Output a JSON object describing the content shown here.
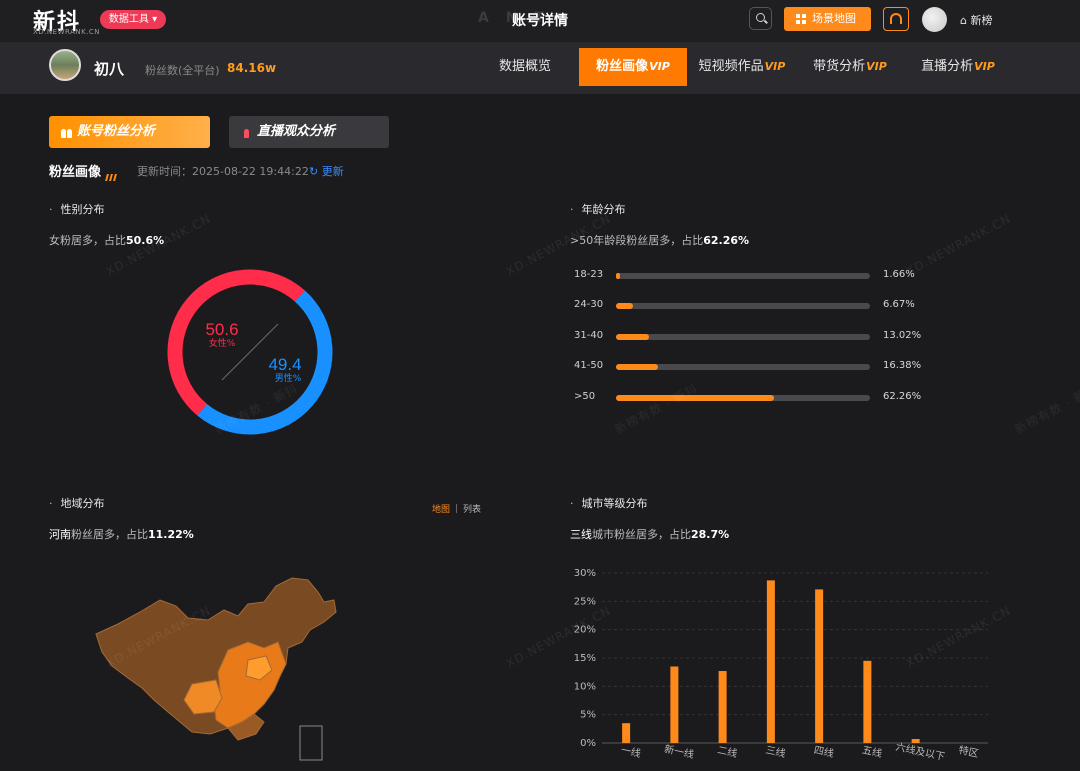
{
  "app": {
    "logo": "新抖",
    "logo_sub": "XD.NEWRANK.CN",
    "tools_badge": "数据工具 ▾",
    "page_title": "账号详情",
    "page_title_ghost": "A      N T",
    "scene_button": "场景地图",
    "home_link": "⌂ 新榜"
  },
  "account": {
    "name": "初八",
    "fans_label": "粉丝数(全平台)",
    "fans_value": "84.16w"
  },
  "nav": {
    "tabs": [
      {
        "label": "数据概览",
        "vip": ""
      },
      {
        "label": "粉丝画像",
        "vip": "VIP"
      },
      {
        "label": "短视频作品",
        "vip": "VIP"
      },
      {
        "label": "带货分析",
        "vip": "VIP"
      },
      {
        "label": "直播分析",
        "vip": "VIP"
      }
    ],
    "active": "粉丝画像"
  },
  "subtabs": {
    "account_fans": "账号粉丝分析",
    "live_audience": "直播观众分析"
  },
  "section": {
    "title": "粉丝画像",
    "update_time": "更新时间：2025-08-22 19:44:22",
    "refresh": "更新"
  },
  "gender": {
    "title": "性别分布",
    "summary_prefix": "女粉",
    "summary_mid": "居多，占比",
    "summary_value": "50.6%",
    "female_value": "50.6",
    "female_label": "女性%",
    "male_value": "49.4",
    "male_label": "男性%",
    "colors": {
      "female": "#ff2d4a",
      "male": "#1890ff"
    }
  },
  "age": {
    "title": "年龄分布",
    "summary_prefix": ">50年龄段粉丝",
    "summary_mid": "居多，占比",
    "summary_value": "62.26%",
    "rows": [
      {
        "label": "18-23",
        "pct": "1.66%",
        "value": 1.66
      },
      {
        "label": "24-30",
        "pct": "6.67%",
        "value": 6.67
      },
      {
        "label": "31-40",
        "pct": "13.02%",
        "value": 13.02
      },
      {
        "label": "41-50",
        "pct": "16.38%",
        "value": 16.38
      },
      {
        "label": ">50",
        "pct": "62.26%",
        "value": 62.26
      }
    ]
  },
  "region": {
    "title": "地域分布",
    "toggle_map": "地图",
    "toggle_list": "列表",
    "summary_prefix": "河南",
    "summary_mid": "粉丝居多，占比",
    "summary_value": "11.22%"
  },
  "city": {
    "title": "城市等级分布",
    "summary_prefix": "三线",
    "summary_mid": "城市粉丝居多，占比",
    "summary_value": "28.7%"
  },
  "chart_data": {
    "type": "bar",
    "categories": [
      "一线",
      "新一线",
      "二线",
      "三线",
      "四线",
      "五线",
      "六线及以下",
      "特区"
    ],
    "values": [
      3.5,
      13.5,
      12.7,
      28.7,
      27.1,
      14.5,
      0.7,
      0
    ],
    "ylim": [
      0,
      30
    ],
    "yticks": [
      "0%",
      "5%",
      "10%",
      "15%",
      "20%",
      "25%",
      "30%"
    ],
    "color": "#ff8a1c",
    "grid": true
  },
  "watermark": "XD.NEWRANK.CN",
  "watermark2": "新榜有数 · 新抖"
}
